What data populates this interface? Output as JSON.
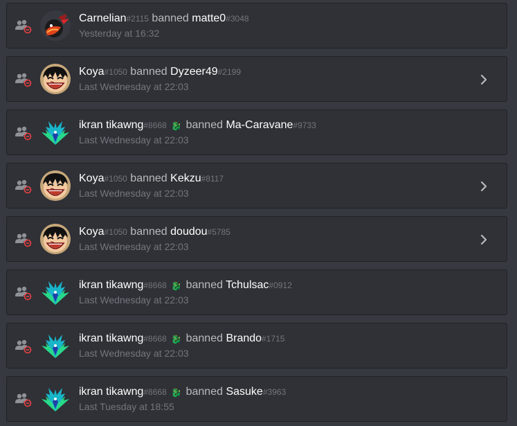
{
  "colors": {
    "background": "#36393f",
    "card": "#2f3136",
    "ban_icon_red": "#ed4245",
    "members_icon_gray": "#8e9297"
  },
  "entries": [
    {
      "actor": "Carnelian",
      "actor_disc": "#2115",
      "verb": "banned",
      "target": "matte0",
      "target_disc": "#3048",
      "time": "Yesterday at 16:32",
      "avatar": "carnelian-avatar",
      "badge": "",
      "expandable": false
    },
    {
      "actor": "Koya",
      "actor_disc": "#1050",
      "verb": "banned",
      "target": "Dyzeer49",
      "target_disc": "#2199",
      "time": "Last Wednesday at 22:03",
      "avatar": "luffy-avatar",
      "badge": "",
      "expandable": true
    },
    {
      "actor": "ikran tikawng",
      "actor_disc": "#8668",
      "verb": "banned",
      "target": "Ma-Caravane",
      "target_disc": "#9733",
      "time": "Last Wednesday at 22:03",
      "avatar": "dragon-avatar",
      "badge": "🐉",
      "expandable": false
    },
    {
      "actor": "Koya",
      "actor_disc": "#1050",
      "verb": "banned",
      "target": "Kekzu",
      "target_disc": "#8117",
      "time": "Last Wednesday at 22:03",
      "avatar": "luffy-avatar",
      "badge": "",
      "expandable": true
    },
    {
      "actor": "Koya",
      "actor_disc": "#1050",
      "verb": "banned",
      "target": "doudou",
      "target_disc": "#5785",
      "time": "Last Wednesday at 22:03",
      "avatar": "luffy-avatar",
      "badge": "",
      "expandable": true
    },
    {
      "actor": "ikran tikawng",
      "actor_disc": "#8668",
      "verb": "banned",
      "target": "Tchulsac",
      "target_disc": "#0912",
      "time": "Last Wednesday at 22:03",
      "avatar": "dragon-avatar",
      "badge": "🐉",
      "expandable": false
    },
    {
      "actor": "ikran tikawng",
      "actor_disc": "#8668",
      "verb": "banned",
      "target": "Brando",
      "target_disc": "#1715",
      "time": "Last Wednesday at 22:03",
      "avatar": "dragon-avatar",
      "badge": "🐉",
      "expandable": false
    },
    {
      "actor": "ikran tikawng",
      "actor_disc": "#8668",
      "verb": "banned",
      "target": "Sasuke",
      "target_disc": "#3963",
      "time": "Last Tuesday at 18:55",
      "avatar": "dragon-avatar",
      "badge": "🐉",
      "expandable": false
    }
  ]
}
